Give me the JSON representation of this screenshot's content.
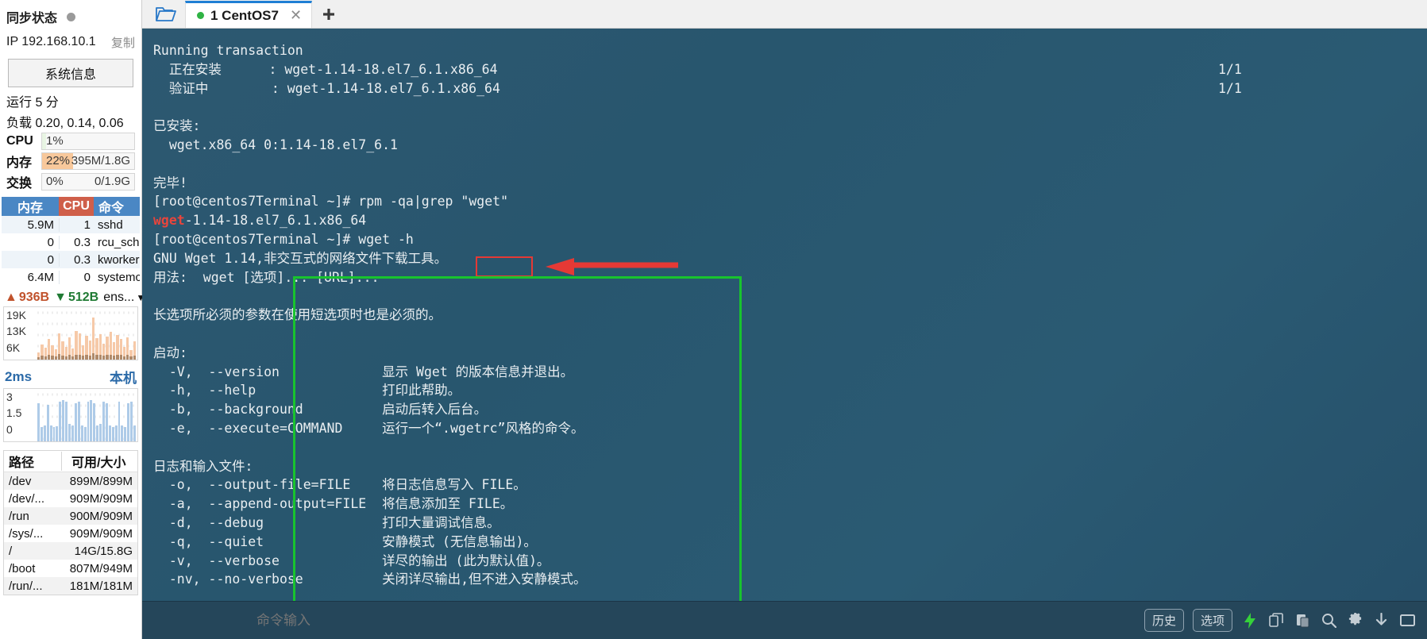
{
  "sidebar": {
    "sync": {
      "label": "同步状态",
      "status_icon": "status-dot"
    },
    "ip": {
      "label": "IP 192.168.10.1",
      "copy_label": "复制"
    },
    "sysinfo_button": "系统信息",
    "uptime": "运行 5 分",
    "load": "负载 0.20, 0.14, 0.06",
    "meters": [
      {
        "name": "CPU",
        "pct": "1%",
        "value": "",
        "fill": 4,
        "color": "#e8f5e3"
      },
      {
        "name": "内存",
        "pct": "22%",
        "value": "395M/1.8G",
        "fill": 34,
        "color": "#f8c89b"
      },
      {
        "name": "交换",
        "pct": "0%",
        "value": "0/1.9G",
        "fill": 0,
        "color": "#e8f5e3"
      }
    ],
    "process_table": {
      "headers": [
        "内存",
        "CPU",
        "命令"
      ],
      "rows": [
        [
          "5.9M",
          "1",
          "sshd"
        ],
        [
          "0",
          "0.3",
          "rcu_sche"
        ],
        [
          "0",
          "0.3",
          "kworker"
        ],
        [
          "6.4M",
          "0",
          "systemc"
        ]
      ]
    },
    "network": {
      "up": "936B",
      "down": "512B",
      "interface": "ens...",
      "up_icon": "arrow-up-icon",
      "down_icon": "arrow-down-icon",
      "dropdown_icon": "chevron-down-icon",
      "y_ticks": [
        "19K",
        "13K",
        "6K"
      ]
    },
    "latency": {
      "value": "2ms",
      "host": "本机",
      "y_ticks": [
        "3",
        "1.5",
        "0"
      ]
    },
    "disk_table": {
      "headers": [
        "路径",
        "可用/大小"
      ],
      "rows": [
        [
          "/dev",
          "899M/899M"
        ],
        [
          "/dev/...",
          "909M/909M"
        ],
        [
          "/run",
          "900M/909M"
        ],
        [
          "/sys/...",
          "909M/909M"
        ],
        [
          "/",
          "14G/15.8G"
        ],
        [
          "/boot",
          "807M/949M"
        ],
        [
          "/run/...",
          "181M/181M"
        ]
      ]
    }
  },
  "tabbar": {
    "folder_icon": "open-folder-icon",
    "tab": {
      "label": "1 CentOS7",
      "status_icon": "connected-dot",
      "close_icon": "close-icon"
    },
    "new_tab_icon": "plus-icon"
  },
  "terminal": {
    "lines": [
      {
        "text": "Running transaction",
        "right": ""
      },
      {
        "text": "  正在安装      : wget-1.14-18.el7_6.1.x86_64",
        "right": "1/1"
      },
      {
        "text": "  验证中        : wget-1.14-18.el7_6.1.x86_64",
        "right": "1/1"
      },
      {
        "text": "",
        "right": ""
      },
      {
        "text": "已安装:",
        "right": ""
      },
      {
        "text": "  wget.x86_64 0:1.14-18.el7_6.1",
        "right": ""
      },
      {
        "text": "",
        "right": ""
      },
      {
        "text": "完毕!",
        "right": ""
      },
      {
        "text": "[root@centos7Terminal ~]# rpm -qa|grep \"wget\"",
        "right": ""
      },
      {
        "text": "-1.14-18.el7_6.1.x86_64",
        "prefix_red": "wget",
        "right": ""
      },
      {
        "text": "[root@centos7Terminal ~]# wget -h",
        "right": ""
      },
      {
        "text": "GNU Wget 1.14,非交互式的网络文件下载工具。",
        "right": ""
      },
      {
        "text": "用法:  wget [选项]... [URL]...",
        "right": ""
      },
      {
        "text": "",
        "right": ""
      },
      {
        "text": "长选项所必须的参数在使用短选项时也是必须的。",
        "right": ""
      },
      {
        "text": "",
        "right": ""
      },
      {
        "text": "启动:",
        "right": ""
      },
      {
        "text": "  -V,  --version             显示 Wget 的版本信息并退出。",
        "right": ""
      },
      {
        "text": "  -h,  --help                打印此帮助。",
        "right": ""
      },
      {
        "text": "  -b,  --background          启动后转入后台。",
        "right": ""
      },
      {
        "text": "  -e,  --execute=COMMAND     运行一个“.wgetrc”风格的命令。",
        "right": ""
      },
      {
        "text": "",
        "right": ""
      },
      {
        "text": "日志和输入文件:",
        "right": ""
      },
      {
        "text": "  -o,  --output-file=FILE    将日志信息写入 FILE。",
        "right": ""
      },
      {
        "text": "  -a,  --append-output=FILE  将信息添加至 FILE。",
        "right": ""
      },
      {
        "text": "  -d,  --debug               打印大量调试信息。",
        "right": ""
      },
      {
        "text": "  -q,  --quiet               安静模式 (无信息输出)。",
        "right": ""
      },
      {
        "text": "  -v,  --verbose             详尽的输出 (此为默认值)。",
        "right": ""
      },
      {
        "text": "  -nv, --no-verbose          关闭详尽输出,但不进入安静模式。",
        "right": ""
      }
    ],
    "highlight_command": "wget -h",
    "annotations": {
      "red_box_color": "#e53935",
      "green_box_color": "#18c32e",
      "arrow_color": "#e53935"
    }
  },
  "cmdbar": {
    "placeholder": "命令输入",
    "value": "",
    "history_label": "历史",
    "options_label": "选项",
    "icons": [
      "lightning-icon",
      "copy-icon",
      "paste-icon",
      "search-icon",
      "gear-icon",
      "download-icon",
      "window-icon"
    ]
  }
}
